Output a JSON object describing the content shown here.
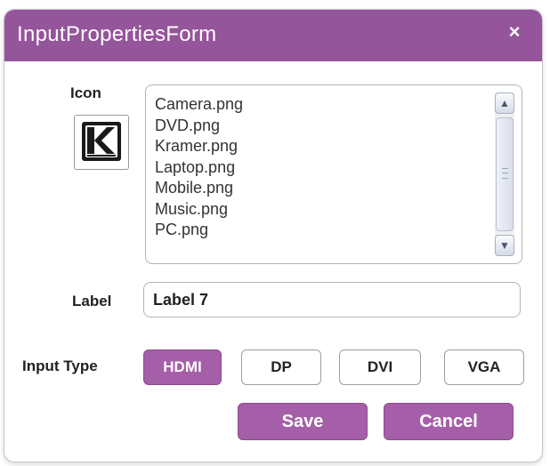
{
  "window": {
    "title": "InputPropertiesForm",
    "close_glyph": "×"
  },
  "icon_section": {
    "label": "Icon",
    "preview_icon": "kramer-logo-icon",
    "files": [
      "Camera.png",
      "DVD.png",
      "Kramer.png",
      "Laptop.png",
      "Mobile.png",
      "Music.png",
      "PC.png"
    ],
    "scroll_up_glyph": "▲",
    "scroll_down_glyph": "▼"
  },
  "label_section": {
    "label": "Label",
    "value": "Label 7"
  },
  "input_type_section": {
    "label": "Input Type",
    "options": [
      "HDMI",
      "DP",
      "DVI",
      "VGA"
    ],
    "selected": "HDMI"
  },
  "actions": {
    "save_label": "Save",
    "cancel_label": "Cancel"
  },
  "colors": {
    "accent": "#a55fa8",
    "titlebar": "#94559a"
  }
}
